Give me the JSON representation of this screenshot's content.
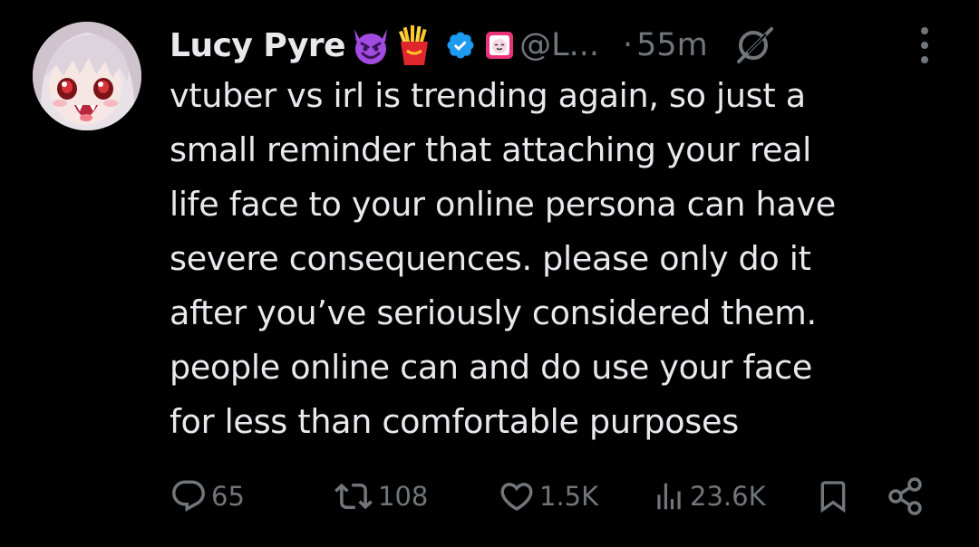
{
  "tweet": {
    "author": {
      "display_name": "Lucy Pyre",
      "handle": "@L...",
      "avatar_icon": "anime-avatar-icon",
      "badges": [
        "smiling-devil-icon",
        "french-fries-icon",
        "verified-badge-icon",
        "affiliate-badge-icon"
      ]
    },
    "separator": "·",
    "time_ago": "55m",
    "text_lines": [
      "vtuber vs irl is trending again, so just a",
      "small reminder that attaching your real",
      "life face to your online persona can have",
      "severe consequences. please only do it",
      "after you’ve seriously considered them.",
      "people online can and do use your face",
      "for less than comfortable purposes"
    ],
    "stats": {
      "replies": "65",
      "reposts": "108",
      "likes": "1.5K",
      "views": "23.6K"
    }
  },
  "colors": {
    "background": "#000000",
    "text_primary": "#e7e9ea",
    "text_secondary": "#71767b",
    "verified_blue": "#1d9bf0",
    "devil_purple": "#a24be0",
    "fries_red": "#e0262d",
    "fries_yellow": "#ffc629",
    "affiliate_pink": "#e8327a"
  }
}
